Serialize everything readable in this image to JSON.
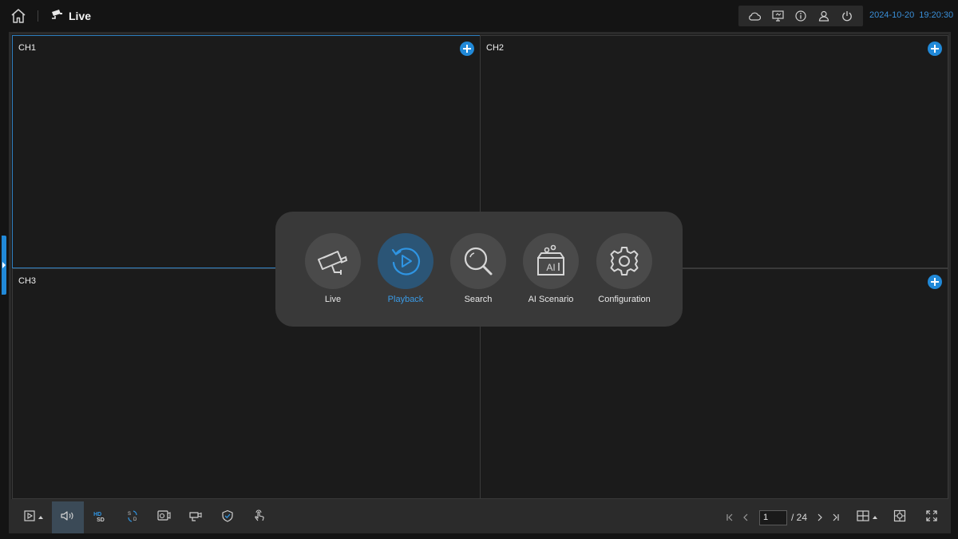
{
  "header": {
    "title": "Live",
    "date": "2024-10-20",
    "time": "19:20:30",
    "tray_icons": [
      "cloud-icon",
      "monitor-icon",
      "info-icon",
      "user-icon",
      "power-icon"
    ]
  },
  "channels": [
    {
      "label": "CH1",
      "active": true
    },
    {
      "label": "CH2",
      "active": false
    },
    {
      "label": "CH3",
      "active": false
    },
    {
      "label": "",
      "active": false
    }
  ],
  "main_menu": {
    "items": [
      {
        "label": "Live",
        "icon": "camera-icon",
        "selected": false
      },
      {
        "label": "Playback",
        "icon": "playback-icon",
        "selected": true
      },
      {
        "label": "Search",
        "icon": "search-icon",
        "selected": false
      },
      {
        "label": "AI Scenario",
        "icon": "ai-scenario-icon",
        "selected": false
      },
      {
        "label": "Configuration",
        "icon": "gear-icon",
        "selected": false
      }
    ]
  },
  "toolbar": {
    "stream_hd": "HD",
    "stream_sd": "SD",
    "audio_pressed": true
  },
  "pager": {
    "current_page": "1",
    "total": "/ 24"
  },
  "colors": {
    "accent": "#2189d8",
    "accent_text": "#3a9be6",
    "selected_circle": "#2b5576"
  }
}
